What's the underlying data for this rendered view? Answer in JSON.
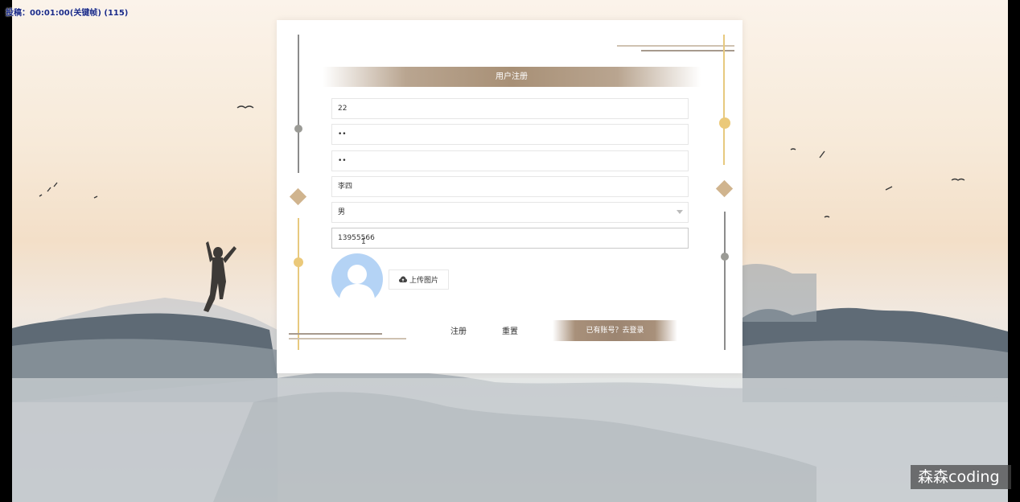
{
  "recording_label": "投稿：00:01:00(关键帧) (115)",
  "card": {
    "title": "用户注册"
  },
  "form": {
    "username": "22",
    "password": "••",
    "confirm_password": "••",
    "name": "李四",
    "gender": "男",
    "phone": "13955566"
  },
  "upload_label": "上传图片",
  "buttons": {
    "register": "注册",
    "reset": "重置",
    "login_link": "已有账号？去登录"
  },
  "watermark": "森森coding",
  "icons": {
    "upload": "cloud-upload-icon",
    "avatar": "user-avatar-placeholder",
    "gender_dropdown": "chevron-down-icon"
  },
  "colors": {
    "accent_bronze": "#a8907a",
    "gold": "#e8c77e",
    "avatar_blue": "#b4d3f5"
  }
}
